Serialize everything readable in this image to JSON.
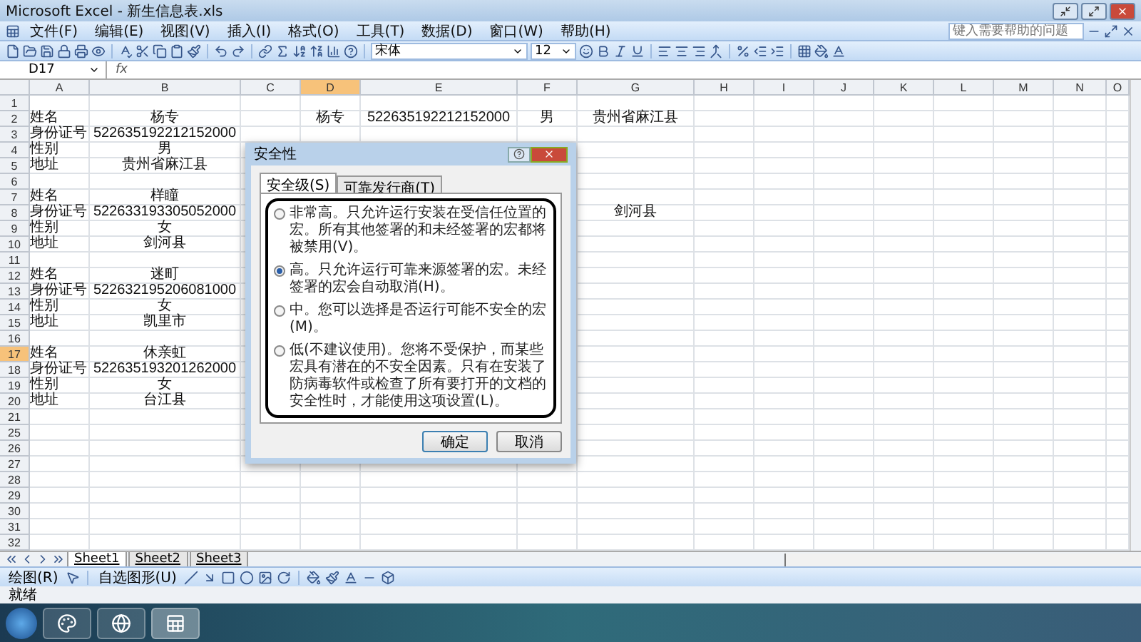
{
  "window": {
    "title": "Microsoft Excel - 新生信息表.xls"
  },
  "menu": [
    "文件(F)",
    "编辑(E)",
    "视图(V)",
    "插入(I)",
    "格式(O)",
    "工具(T)",
    "数据(D)",
    "窗口(W)",
    "帮助(H)"
  ],
  "help_box": {
    "placeholder": "键入需要帮助的问题"
  },
  "format_bar": {
    "font": "宋体",
    "size": "12"
  },
  "formula_bar": {
    "name_box": "D17",
    "fx": "fx"
  },
  "sheet": {
    "columns": [
      {
        "label": "A",
        "selected": false
      },
      {
        "label": "B",
        "selected": false
      },
      {
        "label": "C",
        "selected": false
      },
      {
        "label": "D",
        "selected": true
      },
      {
        "label": "E",
        "selected": false
      },
      {
        "label": "F",
        "selected": false
      },
      {
        "label": "G",
        "selected": false
      },
      {
        "label": "H",
        "selected": false
      },
      {
        "label": "I",
        "selected": false
      },
      {
        "label": "J",
        "selected": false
      },
      {
        "label": "K",
        "selected": false
      },
      {
        "label": "L",
        "selected": false
      },
      {
        "label": "M",
        "selected": false
      },
      {
        "label": "N",
        "selected": false
      },
      {
        "label": "O",
        "selected": false
      }
    ],
    "rows": [
      {
        "label": "1",
        "selected": false,
        "cells": {}
      },
      {
        "label": "2",
        "selected": false,
        "cells": {
          "A": "姓名",
          "B": "杨专",
          "D": "杨专",
          "E": "522635192212152000",
          "F": "男",
          "G": "贵州省麻江县"
        }
      },
      {
        "label": "3",
        "selected": false,
        "cells": {
          "A": "身份证号",
          "B": "522635192212152000"
        }
      },
      {
        "label": "4",
        "selected": false,
        "cells": {
          "A": "性别",
          "B": "男"
        }
      },
      {
        "label": "5",
        "selected": false,
        "cells": {
          "A": "地址",
          "B": "贵州省麻江县"
        }
      },
      {
        "label": "6",
        "selected": false,
        "cells": {}
      },
      {
        "label": "7",
        "selected": false,
        "cells": {
          "A": "姓名",
          "B": "样瞳"
        }
      },
      {
        "label": "8",
        "selected": false,
        "cells": {
          "A": "身份证号",
          "B": "522633193305052000",
          "G": "剑河县"
        }
      },
      {
        "label": "9",
        "selected": false,
        "cells": {
          "A": "性别",
          "B": "女"
        }
      },
      {
        "label": "10",
        "selected": false,
        "cells": {
          "A": "地址",
          "B": "剑河县"
        }
      },
      {
        "label": "11",
        "selected": false,
        "cells": {}
      },
      {
        "label": "12",
        "selected": false,
        "cells": {
          "A": "姓名",
          "B": "迷町"
        }
      },
      {
        "label": "13",
        "selected": false,
        "cells": {
          "A": "身份证号",
          "B": "522632195206081000"
        }
      },
      {
        "label": "14",
        "selected": false,
        "cells": {
          "A": "性别",
          "B": "女"
        }
      },
      {
        "label": "15",
        "selected": false,
        "cells": {
          "A": "地址",
          "B": "凯里市"
        }
      },
      {
        "label": "16",
        "selected": false,
        "cells": {}
      },
      {
        "label": "17",
        "selected": true,
        "cells": {
          "A": "姓名",
          "B": "休亲虹"
        }
      },
      {
        "label": "18",
        "selected": false,
        "cells": {
          "A": "身份证号",
          "B": "522635193201262000"
        }
      },
      {
        "label": "19",
        "selected": false,
        "cells": {
          "A": "性别",
          "B": "女"
        }
      },
      {
        "label": "20",
        "selected": false,
        "cells": {
          "A": "地址",
          "B": "台江县"
        }
      },
      {
        "label": "21",
        "selected": false,
        "cells": {}
      },
      {
        "label": "25",
        "selected": false,
        "cells": {}
      },
      {
        "label": "26",
        "selected": false,
        "cells": {}
      },
      {
        "label": "27",
        "selected": false,
        "cells": {}
      },
      {
        "label": "28",
        "selected": false,
        "cells": {}
      },
      {
        "label": "29",
        "selected": false,
        "cells": {}
      },
      {
        "label": "30",
        "selected": false,
        "cells": {}
      },
      {
        "label": "31",
        "selected": false,
        "cells": {}
      },
      {
        "label": "32",
        "selected": false,
        "cells": {}
      }
    ]
  },
  "dialog": {
    "title": "安全性",
    "tabs": [
      {
        "label": "安全级(S)",
        "selected": true
      },
      {
        "label": "可靠发行商(T)",
        "selected": false
      }
    ],
    "options": [
      {
        "text": "非常高。只允许运行安装在受信任位置的宏。所有其他签署的和未经签署的宏都将被禁用(V)。",
        "selected": false
      },
      {
        "text": "高。只允许运行可靠来源签署的宏。未经签署的宏会自动取消(H)。",
        "selected": true
      },
      {
        "text": "中。您可以选择是否运行可能不安全的宏(M)。",
        "selected": false
      },
      {
        "text": "低(不建议使用)。您将不受保护，而某些宏具有潜在的不安全因素。只有在安装了防病毒软件或检查了所有要打开的文档的安全性时，才能使用这项设置(L)。",
        "selected": false
      }
    ],
    "buttons": [
      "确定",
      "取消"
    ]
  },
  "sheet_tabs": [
    {
      "label": "Sheet1",
      "selected": true
    },
    {
      "label": "Sheet2",
      "selected": false
    },
    {
      "label": "Sheet3",
      "selected": false
    }
  ],
  "drawing_bar": {
    "draw": "绘图(R)",
    "autoshapes": "自选图形(U)"
  },
  "status_bar": "就绪"
}
